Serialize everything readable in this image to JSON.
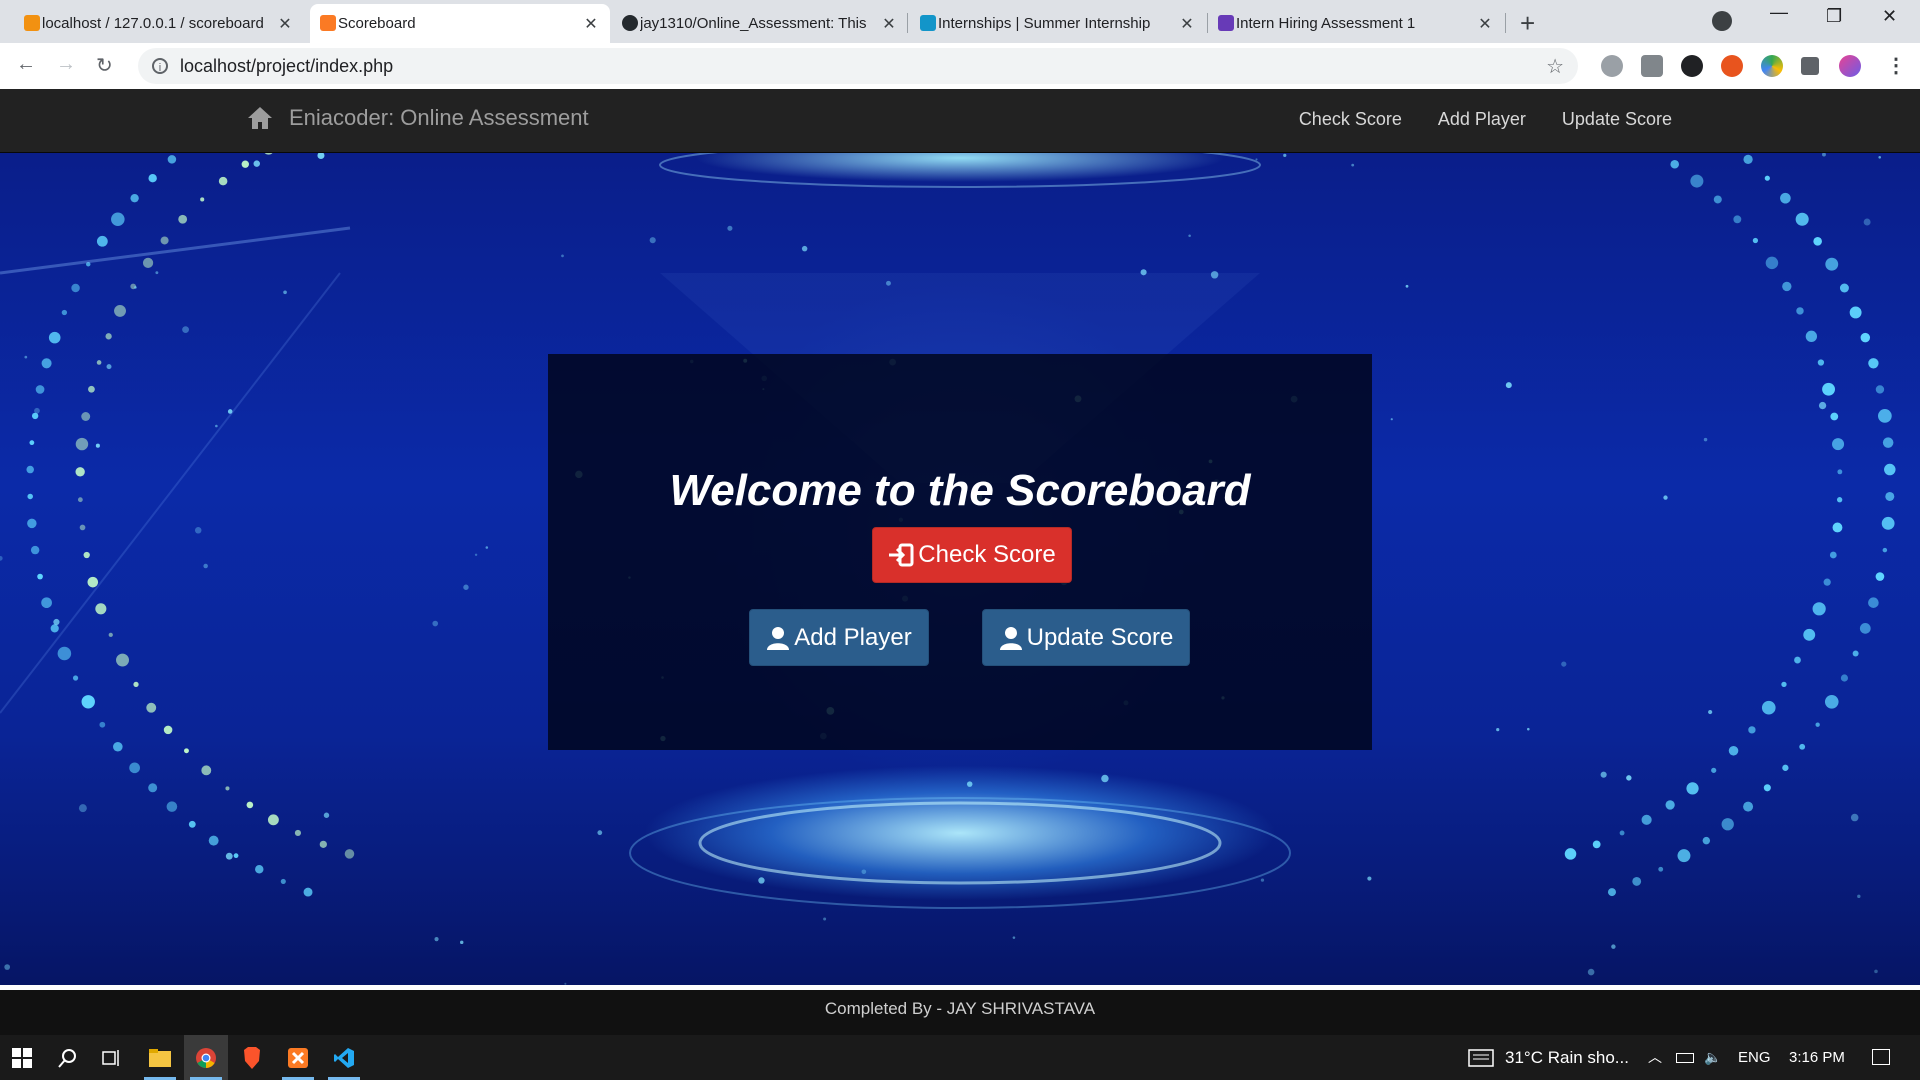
{
  "browser": {
    "tabs": [
      {
        "title": "localhost / 127.0.0.1 / scoreboard",
        "icon": "phpmyadmin-icon",
        "color": "#f29111",
        "active": false
      },
      {
        "title": "Scoreboard",
        "icon": "xampp-icon",
        "color": "#fb7a24",
        "active": true
      },
      {
        "title": "jay1310/Online_Assessment: This",
        "icon": "github-icon",
        "color": "#24292e",
        "active": false
      },
      {
        "title": "Internships | Summer Internship",
        "icon": "internshala-icon",
        "color": "#1295c9",
        "active": false
      },
      {
        "title": "Intern Hiring Assessment 1",
        "icon": "forms-icon",
        "color": "#673ab7",
        "active": false
      }
    ],
    "url": "localhost/project/index.php"
  },
  "navbar": {
    "brand": "Eniacoder: Online Assessment",
    "links": [
      "Check Score",
      "Add Player",
      "Update Score"
    ]
  },
  "hero": {
    "heading": "Welcome to the Scoreboard",
    "check_button": "Check Score",
    "add_button": "Add Player",
    "update_button": "Update Score"
  },
  "footer": {
    "text": "Completed By - JAY SHRIVASTAVA"
  },
  "taskbar": {
    "weather": "31°C  Rain sho...",
    "language": "ENG",
    "time": "3:16 PM"
  },
  "colors": {
    "danger": "#d9302b",
    "primary": "#2b5d8c",
    "navbar": "#222222"
  }
}
